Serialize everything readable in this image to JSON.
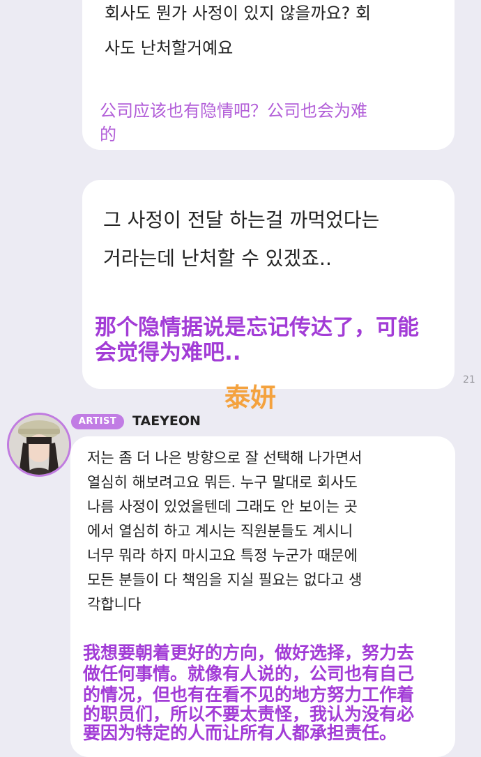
{
  "messages": [
    {
      "korean_lines": [
        "회사도 뭔가 사정이 있지 않을까요? 회",
        "사도 난처할거예요"
      ],
      "chinese_lines": [
        "公司应该也有隐情吧？公司也会为难",
        "的"
      ]
    },
    {
      "korean_lines": [
        "그 사정이 전달 하는걸 까먹었다는",
        "거라는데 난처할 수 있겠죠.."
      ],
      "chinese_lines": [
        "那个隐情据说是忘记传达了，可能",
        "会觉得为难吧.."
      ],
      "timestamp": "21"
    }
  ],
  "overlay_text": "泰妍",
  "artist": {
    "badge": "ARTIST",
    "name": "TAEYEON",
    "korean_lines": [
      "저는 좀 더 나은 방향으로 잘 선택해 나가면서",
      "열심히 해보려고요 뭐든. 누구 말대로 회사도",
      "나름 사정이 있었을텐데 그래도 안 보이는 곳",
      "에서 열심히 하고 계시는 직원분들도 계시니",
      "너무 뭐라 하지 마시고요 특정 누군가 때문에",
      "모든 분들이 다 책임을 지실 필요는 없다고 생",
      "각합니다"
    ],
    "chinese_lines": [
      "我想要朝着更好的方向，做好选择，努力去",
      "做任何事情。就像有人说的，公司也有自己",
      "的情况，但也有在看不见的地方努力工作着",
      "的职员们，所以不要太责怪，我认为没有必",
      "要因为特定的人而让所有人都承担责任。"
    ]
  }
}
